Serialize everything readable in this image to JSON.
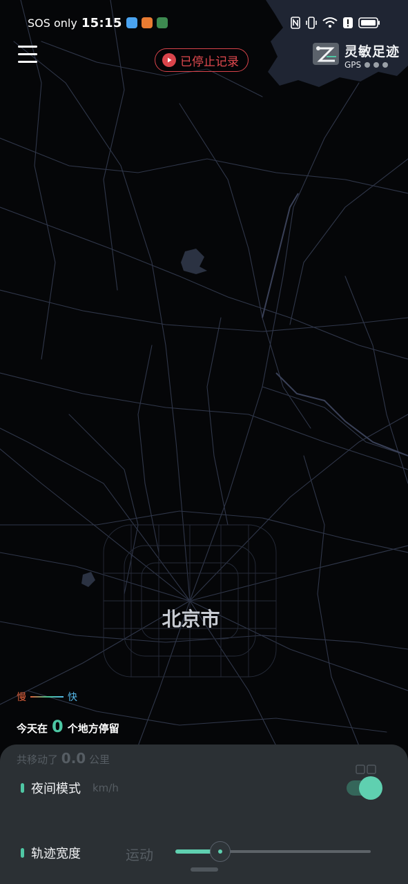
{
  "status_bar": {
    "carrier": "SOS only",
    "time": "15:15",
    "app_icons": [
      "map-app-icon",
      "news-app-icon",
      "game-app-icon"
    ],
    "indicator_icons": [
      "nfc-icon",
      "vibrate-icon",
      "wifi-icon",
      "alert-icon",
      "battery-icon"
    ]
  },
  "header": {
    "menu_icon": "hamburger-menu-icon",
    "record_status": "已停止记录",
    "record_color": "#d9444b",
    "app_name": "灵敏足迹",
    "gps_label": "GPS"
  },
  "map": {
    "city_label": "北京市",
    "background": "#050608",
    "road_color": "#3a4150"
  },
  "legend": {
    "slow_label": "慢",
    "fast_label": "快",
    "slow_color": "#e0603a",
    "fast_color": "#55b7e8"
  },
  "summary": {
    "stay_prefix": "今天在",
    "stay_count": "0",
    "stay_suffix": "个地方停留",
    "accent": "#4cc7a3"
  },
  "panel": {
    "hidden_distance_prefix": "共移动了",
    "hidden_distance_value": "0.0",
    "hidden_distance_unit": "公里",
    "hidden_speed_unit": "km/h",
    "hidden_mode": "运动",
    "night_mode_label": "夜间模式",
    "night_mode_on": true,
    "track_width_label": "轨迹宽度",
    "track_width_level": 0.23
  }
}
